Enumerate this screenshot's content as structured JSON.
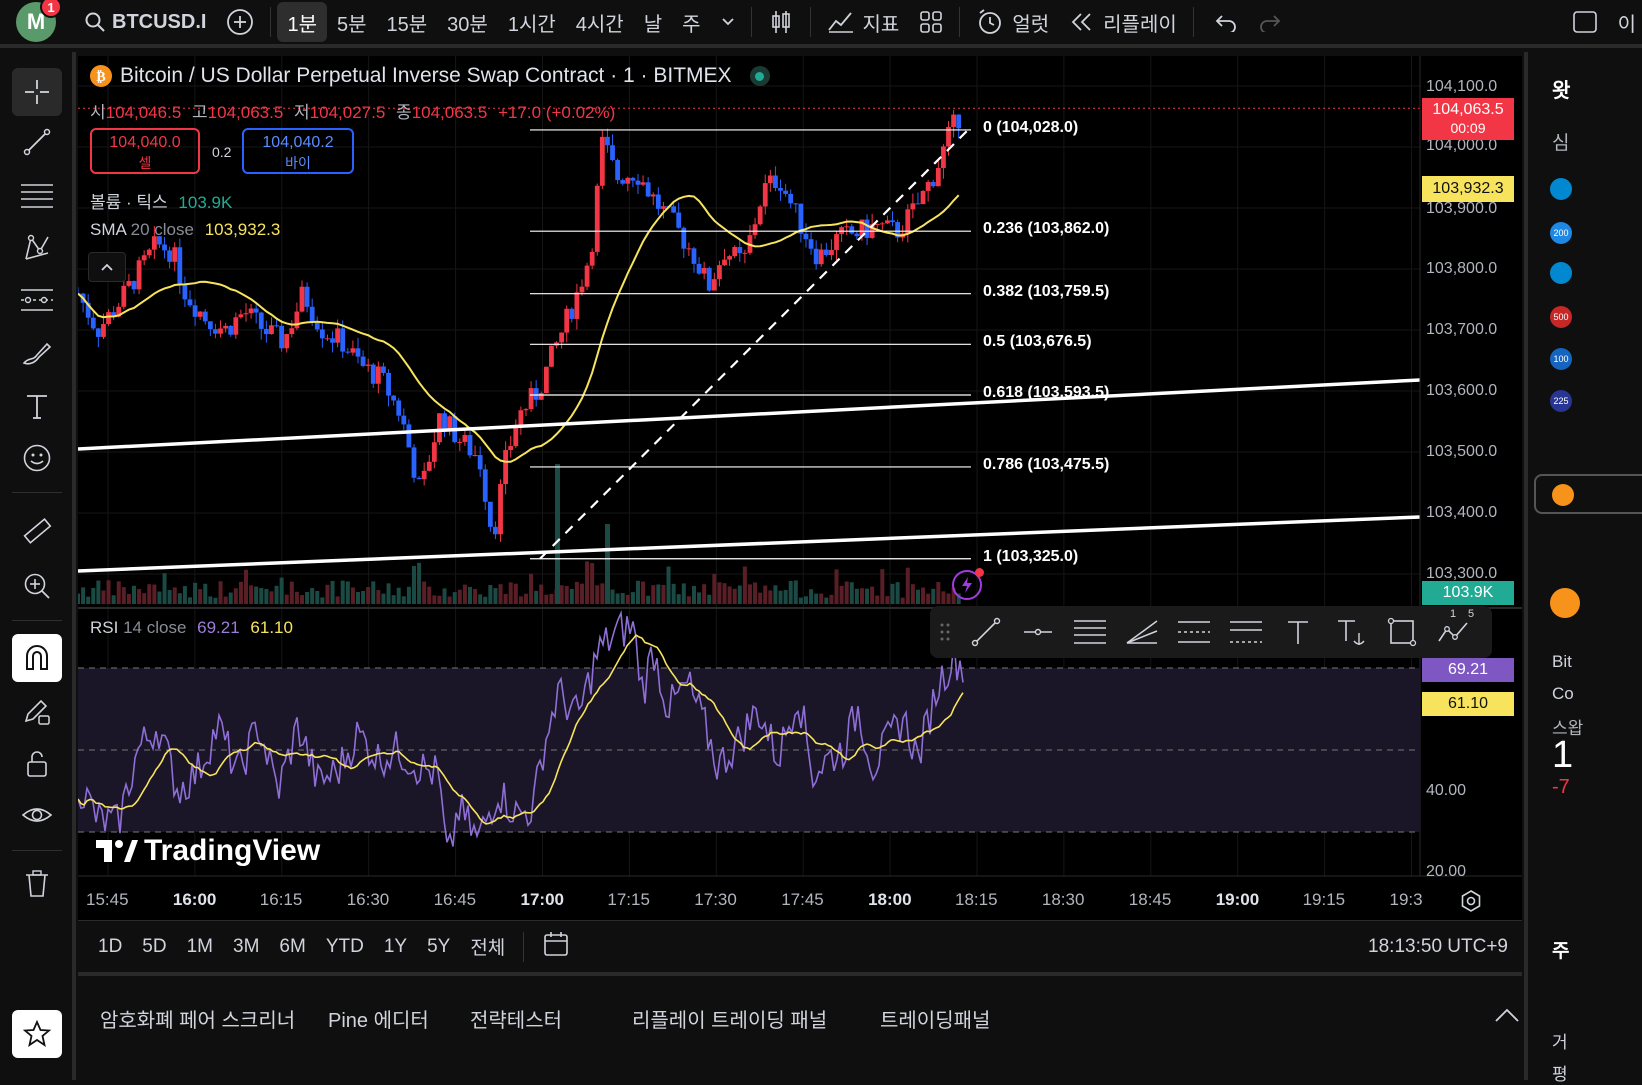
{
  "topbar": {
    "avatar_letter": "M",
    "avatar_badge": "1",
    "symbol": "BTCUSD.I",
    "intervals": [
      "1분",
      "5분",
      "15분",
      "30분",
      "1시간",
      "4시간",
      "날",
      "주"
    ],
    "active_interval": "1분",
    "indicators_label": "지표",
    "alert_label": "얼럿",
    "replay_label": "리플레이",
    "right_cut": "이"
  },
  "legend": {
    "title": "Bitcoin / US Dollar Perpetual Inverse Swap Contract · 1 · BITMEX",
    "open_label": "시",
    "open": "104,046.5",
    "high_label": "고",
    "high": "104,063.5",
    "low_label": "저",
    "low": "104,027.5",
    "close_label": "종",
    "close": "104,063.5",
    "change": "+17.0 (+0.02%)",
    "sell_price": "104,040.0",
    "sell_label": "셀",
    "buy_price": "104,040.2",
    "buy_label": "바이",
    "spread": "0.2",
    "volume_name": "볼륨 · 틱스",
    "volume_value": "103.9K",
    "sma_name": "SMA",
    "sma_params": "20 close",
    "sma_value": "103,932.3"
  },
  "fib": [
    {
      "label": "0 (104,028.0)",
      "price": 104028.0
    },
    {
      "label": "0.236 (103,862.0)",
      "price": 103862.0
    },
    {
      "label": "0.382 (103,759.5)",
      "price": 103759.5
    },
    {
      "label": "0.5 (103,676.5)",
      "price": 103676.5
    },
    {
      "label": "0.618 (103,593.5)",
      "price": 103593.5
    },
    {
      "label": "0.786 (103,475.5)",
      "price": 103475.5
    },
    {
      "label": "1 (103,325.0)",
      "price": 103325.0
    }
  ],
  "price_axis": {
    "labels": [
      "104,100.0",
      "104,000.0",
      "103,900.0",
      "103,800.0",
      "103,700.0",
      "103,600.0",
      "103,500.0",
      "103,400.0",
      "103,300.0"
    ],
    "last_price": "104,063.5",
    "countdown": "00:09",
    "sma_tag": "103,932.3",
    "volume_tag": "103.9K"
  },
  "rsi": {
    "name": "RSI",
    "params": "14 close",
    "value": "69.21",
    "ma_value": "61.10",
    "axis": [
      "40.00",
      "20.00"
    ]
  },
  "time_axis": {
    "labels": [
      "15:45",
      "16:00",
      "16:15",
      "16:30",
      "16:45",
      "17:00",
      "17:15",
      "17:30",
      "17:45",
      "18:00",
      "18:15",
      "18:30",
      "18:45",
      "19:00",
      "19:15",
      "19:3"
    ],
    "bold": [
      "16:00",
      "17:00",
      "18:00",
      "19:00"
    ]
  },
  "ranges": [
    "1D",
    "5D",
    "1M",
    "3M",
    "6M",
    "YTD",
    "1Y",
    "5Y",
    "전체"
  ],
  "clock": "18:13:50 UTC+9",
  "bottom_tabs": [
    "암호화폐 페어 스크리너",
    "Pine 에디터",
    "전략테스터",
    "리플레이 트레이딩 패널",
    "트레이딩패널"
  ],
  "brand": "TradingView",
  "right_panel": {
    "top": "왓",
    "sub": "심",
    "items": [
      "200",
      "500",
      "100",
      "225"
    ],
    "texts": [
      "Bit",
      "Co",
      "스왑",
      "1",
      "-7",
      "주",
      "거",
      "평"
    ]
  },
  "drawbar": {
    "counter_top": "1",
    "counter_right": "5"
  },
  "colors": {
    "up": "#f23645",
    "down": "#2962ff",
    "sma": "#f7e45c",
    "rsi": "#7e57c2",
    "rsi_ma": "#f7e45c",
    "accent_green": "#22ab94"
  },
  "chart_data": {
    "type": "candlestick",
    "x_start": "15:41",
    "interval_minutes": 1,
    "ylim": [
      103280,
      104120
    ],
    "candles": [],
    "rsi_ylim": [
      20,
      80
    ]
  }
}
